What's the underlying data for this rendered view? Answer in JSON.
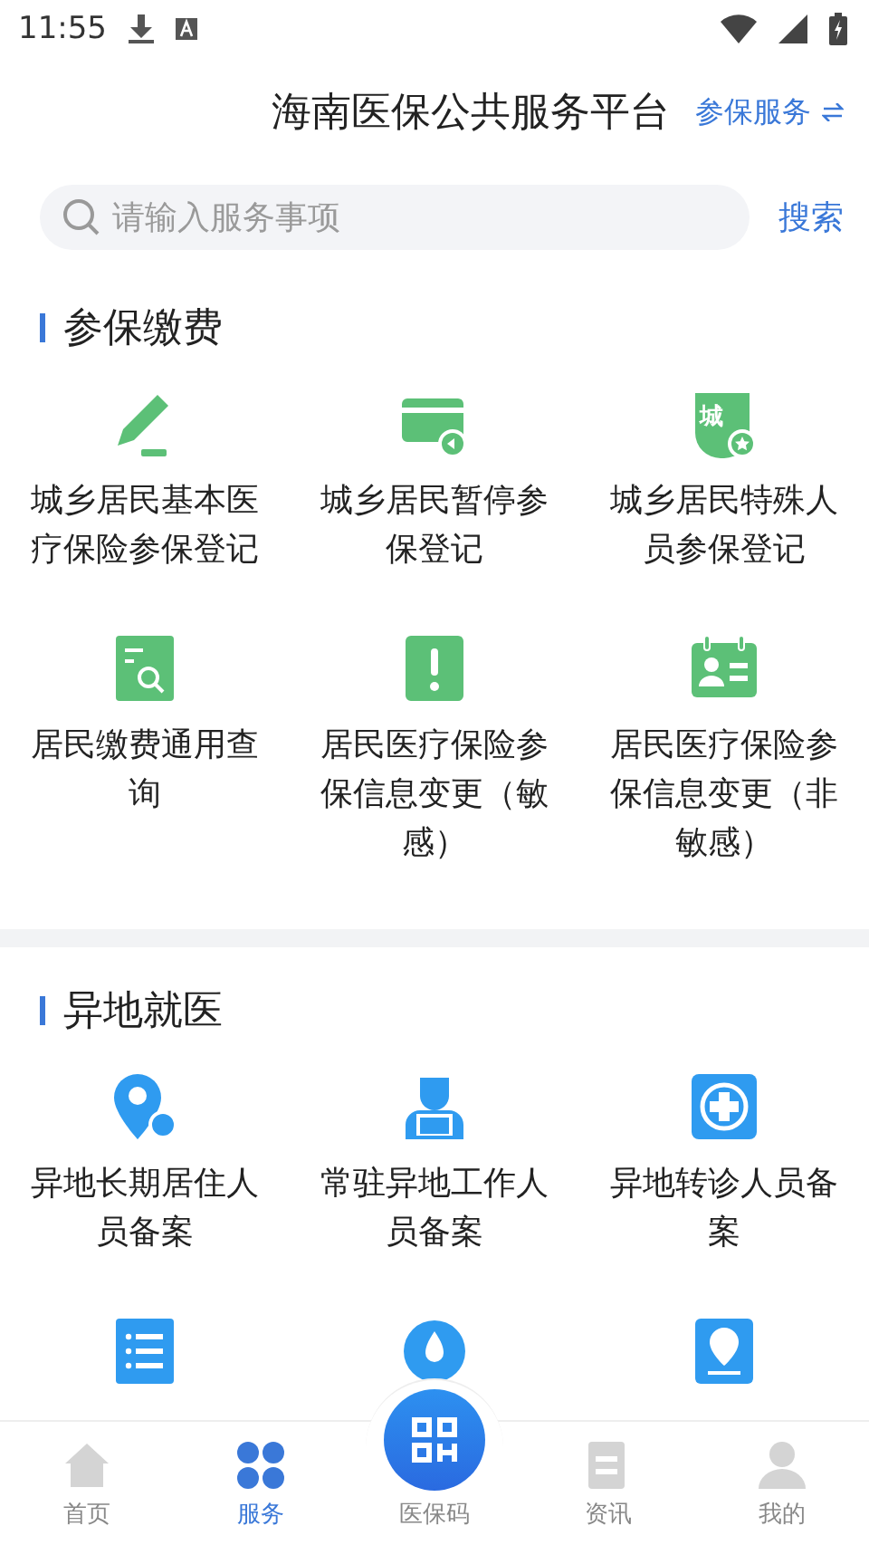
{
  "status_bar": {
    "time": "11:55"
  },
  "header": {
    "title": "海南医保公共服务平台",
    "switch_label": "参保服务"
  },
  "search": {
    "placeholder": "请输入服务事项",
    "button": "搜索"
  },
  "sections": [
    {
      "title": "参保缴费",
      "color": "#5cc077",
      "items": [
        {
          "kind": "pencil",
          "label": "城乡居民基本医疗保险参保登记"
        },
        {
          "kind": "card",
          "label": "城乡居民暂停参保登记"
        },
        {
          "kind": "badge",
          "badge_text": "城",
          "label": "城乡居民特殊人员参保登记"
        },
        {
          "kind": "docsearch",
          "label": "居民缴费通用查询"
        },
        {
          "kind": "alert",
          "label": "居民医疗保险参保信息变更（敏感）"
        },
        {
          "kind": "idcard",
          "label": "居民医疗保险参保信息变更（非敏感）"
        }
      ]
    },
    {
      "title": "异地就医",
      "color": "#2f9bf0",
      "items": [
        {
          "kind": "pin",
          "label": "异地长期居住人员备案"
        },
        {
          "kind": "worker",
          "label": "常驻异地工作人员备案"
        },
        {
          "kind": "cross",
          "label": "异地转诊人员备案"
        },
        {
          "kind": "list"
        },
        {
          "kind": "drop"
        },
        {
          "kind": "yen"
        }
      ]
    }
  ],
  "nav": [
    {
      "kind": "home",
      "label": "首页",
      "selected": false
    },
    {
      "kind": "clover",
      "label": "服务",
      "selected": true
    },
    {
      "kind": "qr",
      "label": "医保码",
      "selected": false
    },
    {
      "kind": "news",
      "label": "资讯",
      "selected": false
    },
    {
      "kind": "person",
      "label": "我的",
      "selected": false
    }
  ]
}
